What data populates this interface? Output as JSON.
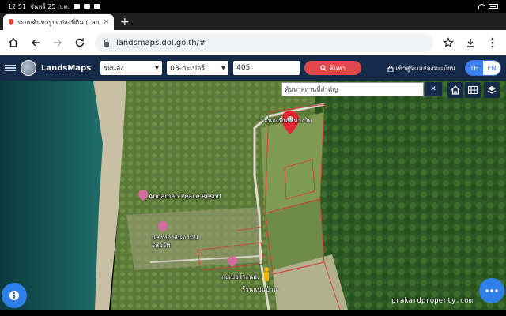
{
  "status_bar": {
    "time": "12:51",
    "date": "จันทร์ 25 ก.ค."
  },
  "browser": {
    "tab_title": "ระบบค้นหารูปแปลงที่ดิน (Lan",
    "new_tab_label": "+",
    "url": "landsmaps.dol.go.th/#"
  },
  "app": {
    "brand": "LandsMaps",
    "province": "ระนอง",
    "district": "03-กะเปอร์",
    "parcel_number": "405",
    "search_label": "ค้นหา",
    "login_label": "เข้าสู่ระบบ/ลงทะเบียน",
    "lang_th": "TH",
    "lang_en": "EN"
  },
  "map": {
    "place_search_placeholder": "ค้นหาสถานที่สำคัญ",
    "clear_label": "✕",
    "labels": {
      "parcel": "ระนองพื้นที่ ห่างวัด",
      "resort": "Andaman Peace Resort",
      "store": "แสงทองอันดามัน\nรีสอร์ท",
      "ranong": "กะเปอร์ระนอง",
      "hotel": "ร้านแปนบ้าน"
    },
    "watermark": "prakardproperty.com"
  },
  "colors": {
    "header_bg": "#162a49",
    "accent": "#e0474c",
    "fab": "#2f7fe8"
  },
  "icons": [
    "maps-icon",
    "home-icon",
    "back-icon",
    "forward-icon",
    "reload-icon",
    "lock-icon",
    "star-icon",
    "download-icon",
    "menu-icon",
    "search-icon",
    "user-icon",
    "building-icon",
    "grid-icon",
    "layers-icon",
    "map-marker-icon",
    "more-icon"
  ]
}
